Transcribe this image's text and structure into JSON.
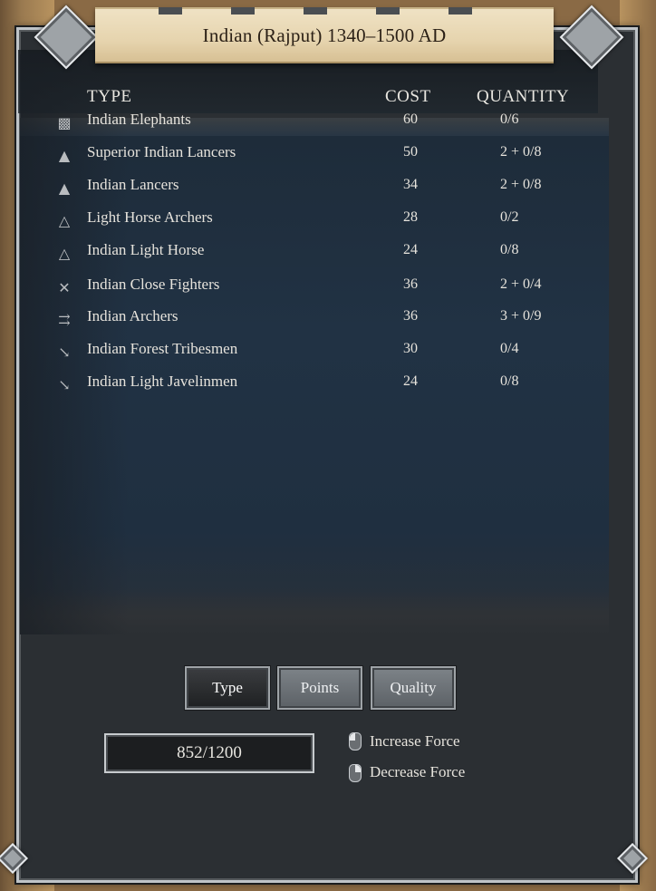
{
  "title": "Indian (Rajput) 1340–1500 AD",
  "table": {
    "headers": {
      "type": "TYPE",
      "cost": "COST",
      "quantity": "QUANTITY"
    },
    "rows": [
      {
        "icon": "elephant-icon",
        "name": "Indian Elephants",
        "cost": "60",
        "quantity": "0/6"
      },
      {
        "icon": "heavy-cavalry-icon",
        "name": "Superior Indian Lancers",
        "cost": "50",
        "quantity": "2 + 0/8"
      },
      {
        "icon": "heavy-cavalry-icon",
        "name": "Indian Lancers",
        "cost": "34",
        "quantity": "2 + 0/8"
      },
      {
        "icon": "light-cavalry-icon",
        "name": "Light Horse Archers",
        "cost": "28",
        "quantity": "0/2"
      },
      {
        "icon": "light-cavalry-icon",
        "name": "Indian Light Horse",
        "cost": "24",
        "quantity": "0/8"
      },
      {
        "icon": "crossed-swords-icon",
        "name": "Indian Close Fighters",
        "cost": "36",
        "quantity": "2 + 0/4"
      },
      {
        "icon": "arrows-icon",
        "name": "Indian Archers",
        "cost": "36",
        "quantity": "3 + 0/9"
      },
      {
        "icon": "javelin-icon",
        "name": "Indian Forest Tribesmen",
        "cost": "30",
        "quantity": "0/4"
      },
      {
        "icon": "javelin-icon",
        "name": "Indian Light Javelinmen",
        "cost": "24",
        "quantity": "0/8"
      }
    ]
  },
  "sort_buttons": {
    "type": "Type",
    "points": "Points",
    "quality": "Quality",
    "active": "Type"
  },
  "force": {
    "value": "852/1200"
  },
  "hints": {
    "increase": "Increase Force",
    "decrease": "Decrease Force"
  },
  "colors": {
    "panel": "#2b2f33",
    "text": "#e6e3dc",
    "scroll": "#e6d4ae"
  }
}
